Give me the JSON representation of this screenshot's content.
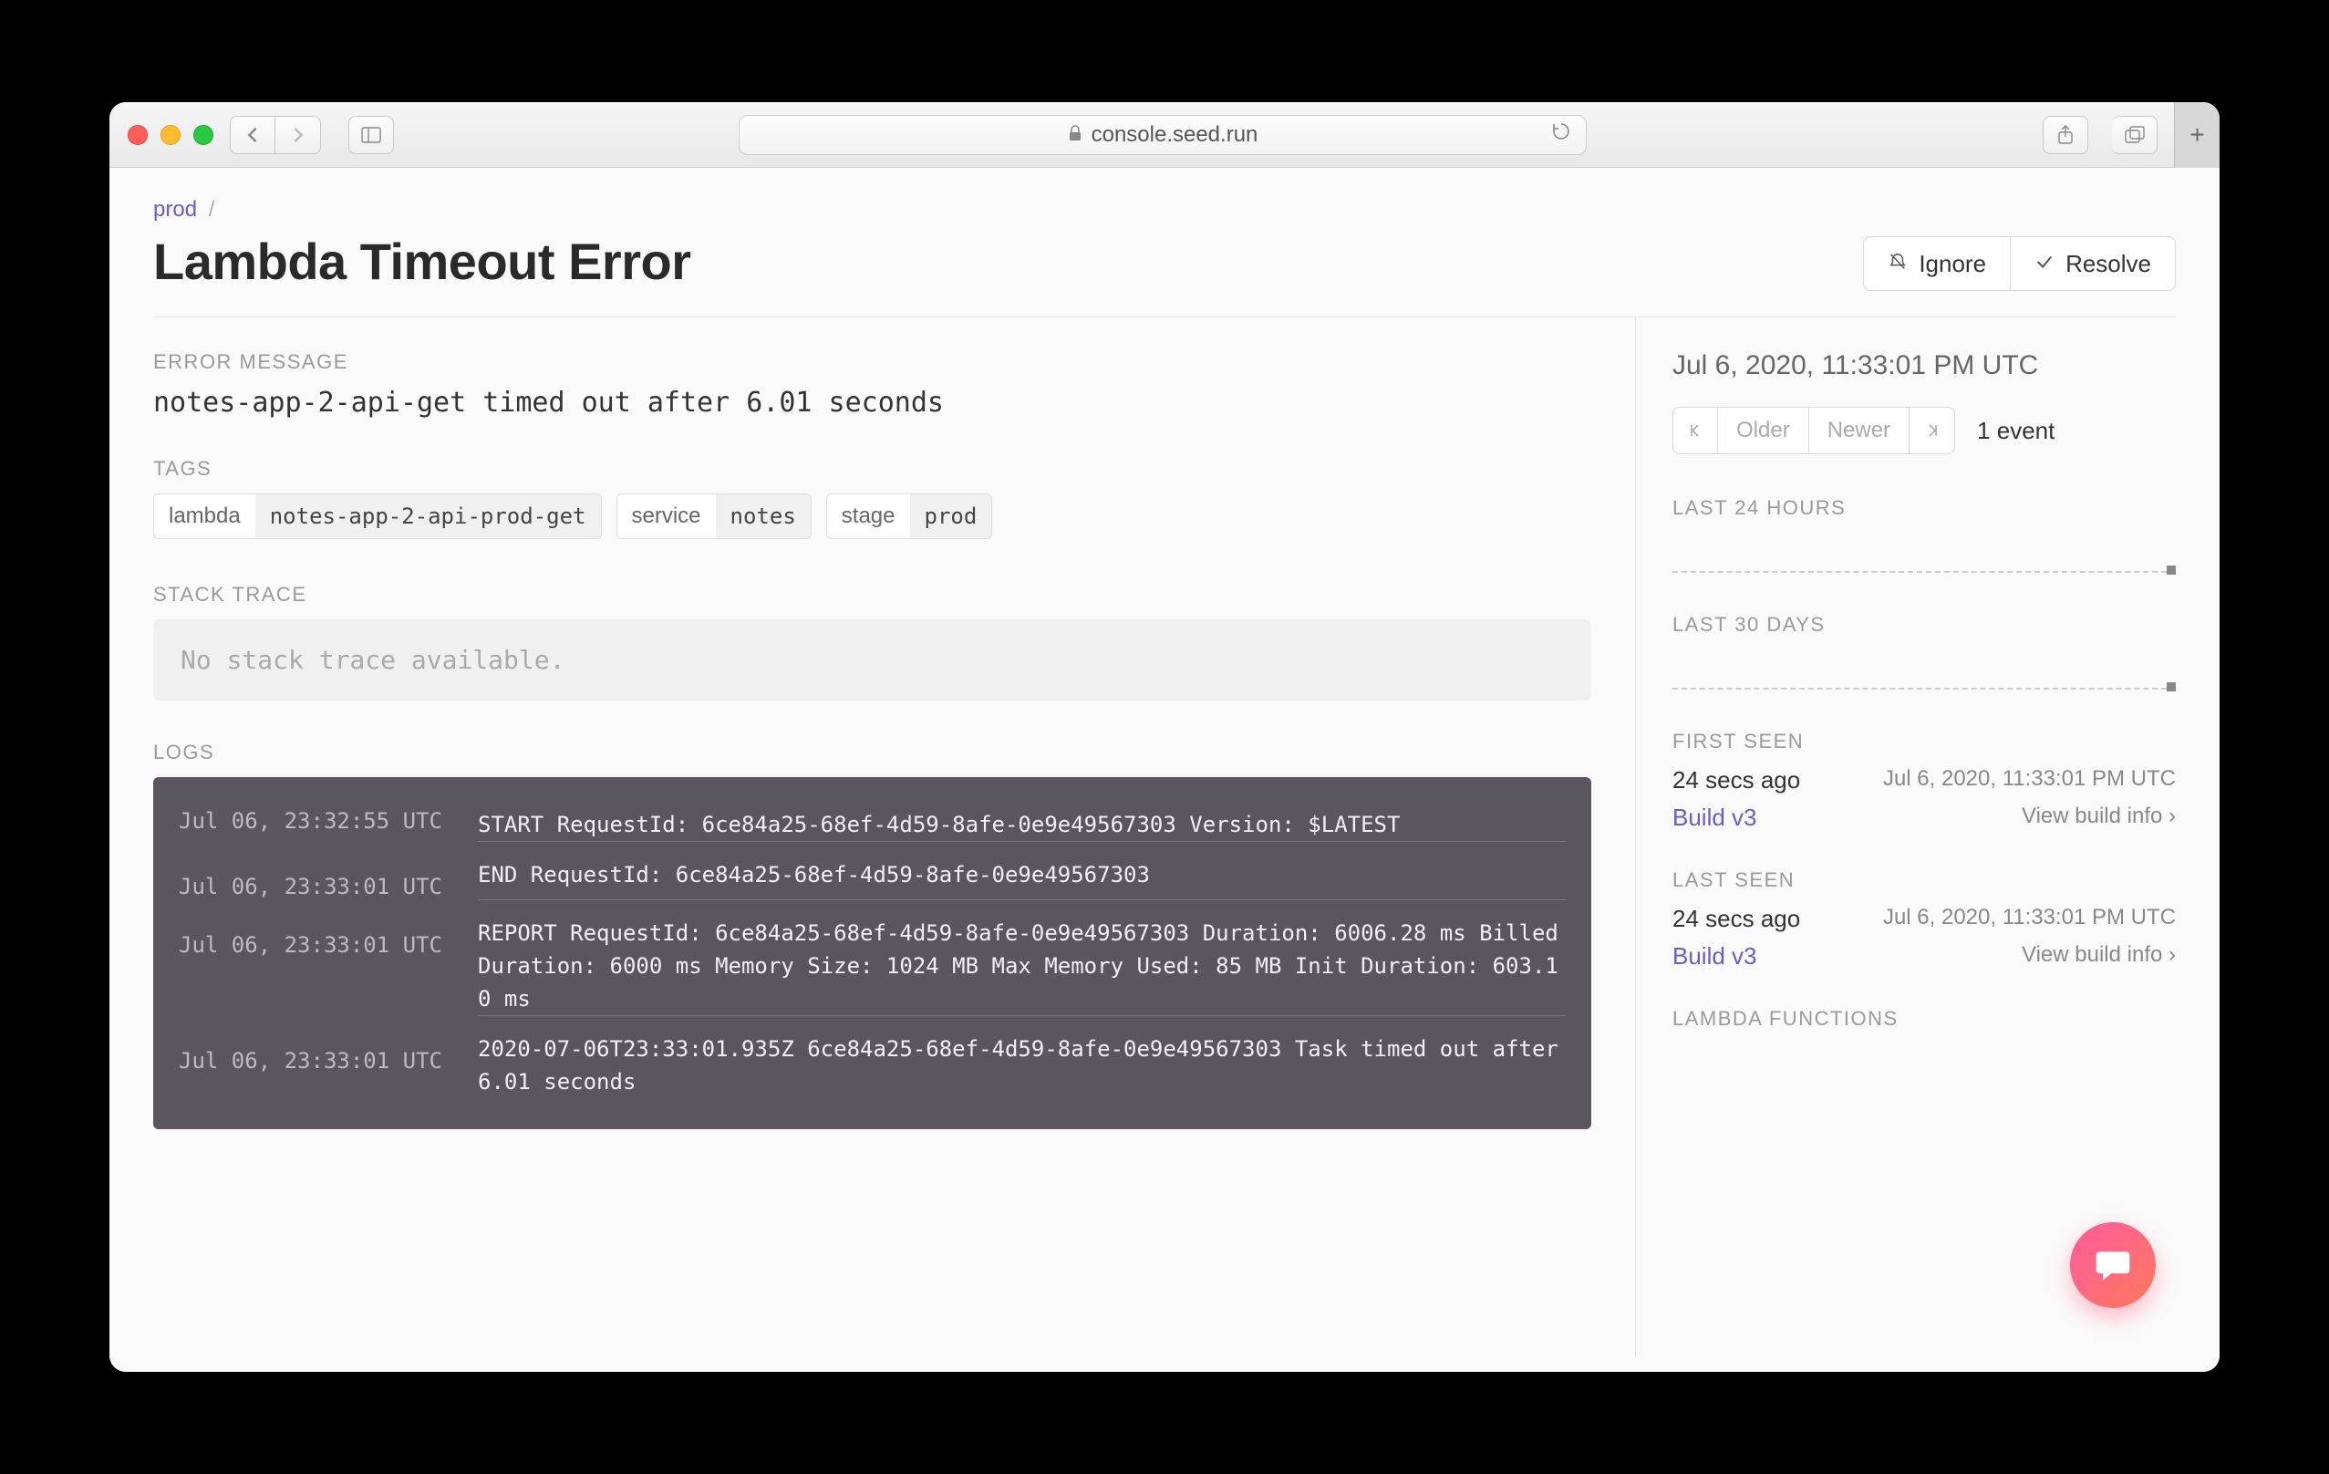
{
  "browser": {
    "url": "console.seed.run"
  },
  "breadcrumb": {
    "root": "prod",
    "sep": "/"
  },
  "title": "Lambda Timeout Error",
  "actions": {
    "ignore": "Ignore",
    "resolve": "Resolve"
  },
  "sections": {
    "error_message_label": "ERROR MESSAGE",
    "error_message": "notes-app-2-api-get timed out after 6.01 seconds",
    "tags_label": "TAGS",
    "stack_trace_label": "STACK TRACE",
    "stack_trace_value": "No stack trace available.",
    "logs_label": "LOGS"
  },
  "tags": [
    {
      "k": "lambda",
      "v": "notes-app-2-api-prod-get"
    },
    {
      "k": "service",
      "v": "notes"
    },
    {
      "k": "stage",
      "v": "prod"
    }
  ],
  "logs": [
    {
      "ts": "Jul 06, 23:32:55 UTC",
      "msg": "START RequestId: 6ce84a25-68ef-4d59-8afe-0e9e49567303 Version: $LATEST"
    },
    {
      "ts": "Jul 06, 23:33:01 UTC",
      "msg": "END RequestId: 6ce84a25-68ef-4d59-8afe-0e9e49567303"
    },
    {
      "ts": "Jul 06, 23:33:01 UTC",
      "msg": "REPORT RequestId: 6ce84a25-68ef-4d59-8afe-0e9e49567303 Duration: 6006.28 ms Billed Duration: 6000 ms Memory Size: 1024 MB Max Memory Used: 85 MB Init Duration: 603.10 ms"
    },
    {
      "ts": "Jul 06, 23:33:01 UTC",
      "msg": "2020-07-06T23:33:01.935Z 6ce84a25-68ef-4d59-8afe-0e9e49567303 Task timed out after 6.01 seconds"
    }
  ],
  "side": {
    "timestamp": "Jul 6, 2020, 11:33:01 PM UTC",
    "pager": {
      "older": "Older",
      "newer": "Newer"
    },
    "event_count": "1 event",
    "last24_label": "LAST 24 HOURS",
    "last30_label": "LAST 30 DAYS",
    "first_seen_label": "FIRST SEEN",
    "last_seen_label": "LAST SEEN",
    "ago": "24 secs ago",
    "date": "Jul 6, 2020, 11:33:01 PM UTC",
    "build": "Build v3",
    "build_info": "View build info ›",
    "lambda_fns_label": "LAMBDA FUNCTIONS"
  }
}
